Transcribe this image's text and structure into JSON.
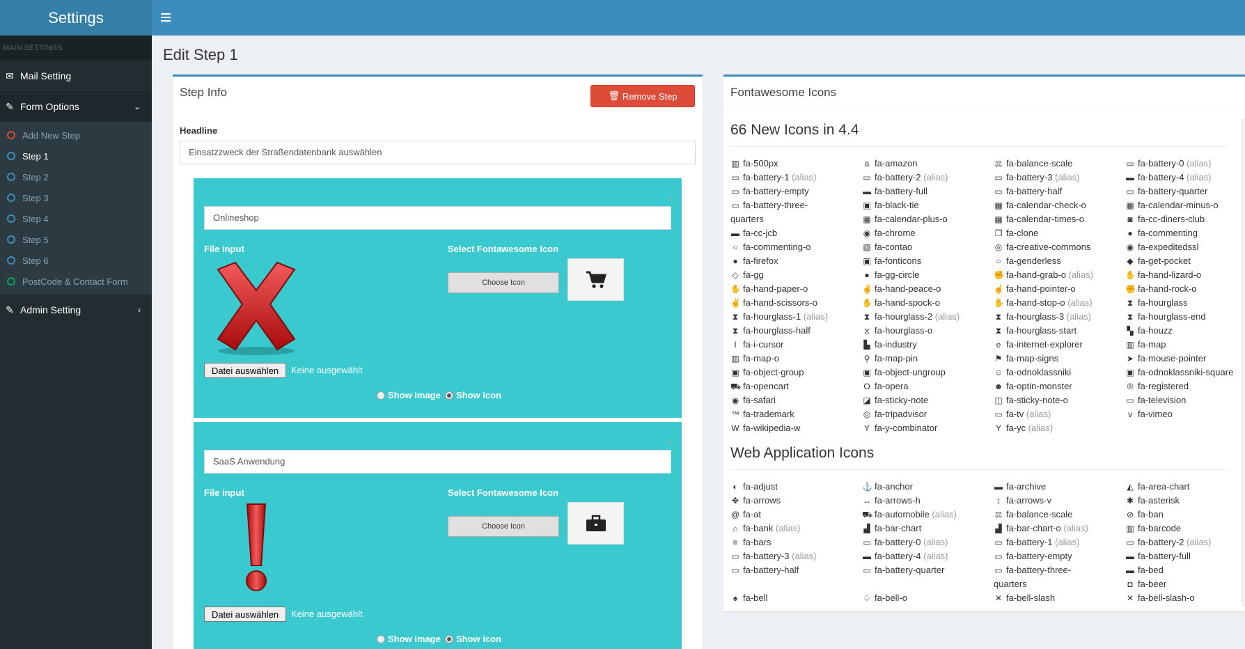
{
  "header": {
    "logo": "Settings"
  },
  "sidebar": {
    "section_title": "MAIN SETTINGS",
    "mail": "Mail Setting",
    "form_options": "Form Options",
    "sub_items": [
      {
        "label": "Add New Step",
        "color": "#dd4b39"
      },
      {
        "label": "Step 1",
        "color": "#3c8dbc"
      },
      {
        "label": "Step 2",
        "color": "#3c8dbc"
      },
      {
        "label": "Step 3",
        "color": "#3c8dbc"
      },
      {
        "label": "Step 4",
        "color": "#3c8dbc"
      },
      {
        "label": "Step 5",
        "color": "#3c8dbc"
      },
      {
        "label": "Step 6",
        "color": "#3c8dbc"
      },
      {
        "label": "PostCode & Contact Form",
        "color": "#00a65a"
      }
    ],
    "admin": "Admin Setting"
  },
  "page": {
    "title": "Edit Step 1"
  },
  "step_info": {
    "title": "Step Info",
    "remove_button": "Remove Step",
    "headline_label": "Headline",
    "headline_value": "Einsatzzweck der Straßendatenbank auswählen",
    "cards": [
      {
        "input_value": "Onlineshop",
        "file_label": "File input",
        "select_label": "Select Fontawesome Icon",
        "choose_button": "Choose Icon",
        "file_button": "Datei auswählen",
        "file_status": "Keine ausgewählt",
        "show_image": "Show image",
        "show_icon": "Show icon",
        "image": "red-x-icon",
        "icon": "shopping-cart-icon"
      },
      {
        "input_value": "SaaS Anwendung",
        "file_label": "File input",
        "select_label": "Select Fontawesome Icon",
        "choose_button": "Choose Icon",
        "file_button": "Datei auswählen",
        "file_status": "Keine ausgewählt",
        "show_image": "Show image",
        "show_icon": "Show icon",
        "image": "red-exclamation-icon",
        "icon": "briefcase-icon"
      }
    ]
  },
  "fontawesome": {
    "title": "Fontawesome Icons",
    "section1": "66 New Icons in 4.4",
    "section2": "Web Application Icons",
    "new_icons": [
      [
        "fa-500px",
        "",
        "▥"
      ],
      [
        "fa-amazon",
        "",
        "a"
      ],
      [
        "fa-balance-scale",
        "",
        "⚖"
      ],
      [
        "fa-battery-0",
        "(alias)",
        "▭"
      ],
      [
        "fa-battery-1",
        "(alias)",
        "▭"
      ],
      [
        "fa-battery-2",
        "(alias)",
        "▭"
      ],
      [
        "fa-battery-3",
        "(alias)",
        "▭"
      ],
      [
        "fa-battery-4",
        "(alias)",
        "▬"
      ],
      [
        "fa-battery-empty",
        "",
        "▭"
      ],
      [
        "fa-battery-full",
        "",
        "▬"
      ],
      [
        "fa-battery-half",
        "",
        "▭"
      ],
      [
        "fa-battery-quarter",
        "",
        "▭"
      ],
      [
        "fa-battery-three-",
        "",
        "▭"
      ],
      [
        "fa-black-tie",
        "",
        "▣"
      ],
      [
        "fa-calendar-check-o",
        "",
        "▦"
      ],
      [
        "fa-calendar-minus-o",
        "",
        "▦"
      ],
      [
        "quarters",
        "",
        ""
      ],
      [
        "fa-calendar-plus-o",
        "",
        "▦"
      ],
      [
        "fa-calendar-times-o",
        "",
        "▦"
      ],
      [
        "fa-cc-diners-club",
        "",
        "◙"
      ],
      [
        "fa-cc-jcb",
        "",
        "▬"
      ],
      [
        "fa-chrome",
        "",
        "◉"
      ],
      [
        "fa-clone",
        "",
        "❐"
      ],
      [
        "fa-commenting",
        "",
        "●"
      ],
      [
        "fa-commenting-o",
        "",
        "○"
      ],
      [
        "fa-contao",
        "",
        "▧"
      ],
      [
        "fa-creative-commons",
        "",
        "◎"
      ],
      [
        "fa-expeditedssl",
        "",
        "◉"
      ],
      [
        "fa-firefox",
        "",
        "●"
      ],
      [
        "fa-fonticons",
        "",
        "▣"
      ],
      [
        "fa-genderless",
        "",
        "○"
      ],
      [
        "fa-get-pocket",
        "",
        "◆"
      ],
      [
        "fa-gg",
        "",
        "◇"
      ],
      [
        "fa-gg-circle",
        "",
        "●"
      ],
      [
        "fa-hand-grab-o",
        "(alias)",
        "✊"
      ],
      [
        "fa-hand-lizard-o",
        "",
        "✋"
      ],
      [
        "fa-hand-paper-o",
        "",
        "✋"
      ],
      [
        "fa-hand-peace-o",
        "",
        "✌"
      ],
      [
        "fa-hand-pointer-o",
        "",
        "☝"
      ],
      [
        "fa-hand-rock-o",
        "",
        "✊"
      ],
      [
        "fa-hand-scissors-o",
        "",
        "✌"
      ],
      [
        "fa-hand-spock-o",
        "",
        "✋"
      ],
      [
        "fa-hand-stop-o",
        "(alias)",
        "✋"
      ],
      [
        "fa-hourglass",
        "",
        "⧗"
      ],
      [
        "fa-hourglass-1",
        "(alias)",
        "⧗"
      ],
      [
        "fa-hourglass-2",
        "(alias)",
        "⧗"
      ],
      [
        "fa-hourglass-3",
        "(alias)",
        "⧗"
      ],
      [
        "fa-hourglass-end",
        "",
        "⧗"
      ],
      [
        "fa-hourglass-half",
        "",
        "⧗"
      ],
      [
        "fa-hourglass-o",
        "",
        "⧖"
      ],
      [
        "fa-hourglass-start",
        "",
        "⧗"
      ],
      [
        "fa-houzz",
        "",
        "▚"
      ],
      [
        "fa-i-cursor",
        "",
        "I"
      ],
      [
        "fa-industry",
        "",
        "▙"
      ],
      [
        "fa-internet-explorer",
        "",
        "e"
      ],
      [
        "fa-map",
        "",
        "▥"
      ],
      [
        "fa-map-o",
        "",
        "▥"
      ],
      [
        "fa-map-pin",
        "",
        "⚲"
      ],
      [
        "fa-map-signs",
        "",
        "⚑"
      ],
      [
        "fa-mouse-pointer",
        "",
        "➤"
      ],
      [
        "fa-object-group",
        "",
        "▣"
      ],
      [
        "fa-object-ungroup",
        "",
        "▣"
      ],
      [
        "fa-odnoklassniki",
        "",
        "☺"
      ],
      [
        "fa-odnoklassniki-square",
        "",
        "▣"
      ],
      [
        "fa-opencart",
        "",
        "⛟"
      ],
      [
        "fa-opera",
        "",
        "O"
      ],
      [
        "fa-optin-monster",
        "",
        "☻"
      ],
      [
        "fa-registered",
        "",
        "®"
      ],
      [
        "fa-safari",
        "",
        "◉"
      ],
      [
        "fa-sticky-note",
        "",
        "◪"
      ],
      [
        "fa-sticky-note-o",
        "",
        "◫"
      ],
      [
        "fa-television",
        "",
        "▭"
      ],
      [
        "fa-trademark",
        "",
        "™"
      ],
      [
        "fa-tripadvisor",
        "",
        "◎"
      ],
      [
        "fa-tv",
        "(alias)",
        "▭"
      ],
      [
        "fa-vimeo",
        "",
        "v"
      ],
      [
        "fa-wikipedia-w",
        "",
        "W"
      ],
      [
        "fa-y-combinator",
        "",
        "Y"
      ],
      [
        "fa-yc",
        "(alias)",
        "Y"
      ],
      [
        "",
        "",
        ""
      ]
    ],
    "web_icons": [
      [
        "fa-adjust",
        "",
        "◐"
      ],
      [
        "fa-anchor",
        "",
        "⚓"
      ],
      [
        "fa-archive",
        "",
        "▬"
      ],
      [
        "fa-area-chart",
        "",
        "◭"
      ],
      [
        "fa-arrows",
        "",
        "✥"
      ],
      [
        "fa-arrows-h",
        "",
        "↔"
      ],
      [
        "fa-arrows-v",
        "",
        "↕"
      ],
      [
        "fa-asterisk",
        "",
        "✱"
      ],
      [
        "fa-at",
        "",
        "@"
      ],
      [
        "fa-automobile",
        "(alias)",
        "⛟"
      ],
      [
        "fa-balance-scale",
        "",
        "⚖"
      ],
      [
        "fa-ban",
        "",
        "⊘"
      ],
      [
        "fa-bank",
        "(alias)",
        "⌂"
      ],
      [
        "fa-bar-chart",
        "",
        "▟"
      ],
      [
        "fa-bar-chart-o",
        "(alias)",
        "▟"
      ],
      [
        "fa-barcode",
        "",
        "▥"
      ],
      [
        "fa-bars",
        "",
        "≡"
      ],
      [
        "fa-battery-0",
        "(alias)",
        "▭"
      ],
      [
        "fa-battery-1",
        "(alias)",
        "▭"
      ],
      [
        "fa-battery-2",
        "(alias)",
        "▭"
      ],
      [
        "fa-battery-3",
        "(alias)",
        "▭"
      ],
      [
        "fa-battery-4",
        "(alias)",
        "▬"
      ],
      [
        "fa-battery-empty",
        "",
        "▭"
      ],
      [
        "fa-battery-full",
        "",
        "▬"
      ],
      [
        "fa-battery-half",
        "",
        "▭"
      ],
      [
        "fa-battery-quarter",
        "",
        "▭"
      ],
      [
        "fa-battery-three-",
        "",
        "▭"
      ],
      [
        "fa-bed",
        "",
        "▬"
      ],
      [
        "",
        "",
        ""
      ],
      [
        "",
        "",
        ""
      ],
      [
        "quarters",
        "",
        ""
      ],
      [
        "fa-beer",
        "",
        "◘"
      ],
      [
        "fa-bell",
        "",
        "♠"
      ],
      [
        "fa-bell-o",
        "",
        "♤"
      ],
      [
        "fa-bell-slash",
        "",
        "✕"
      ],
      [
        "fa-bell-slash-o",
        "",
        "✕"
      ]
    ]
  }
}
